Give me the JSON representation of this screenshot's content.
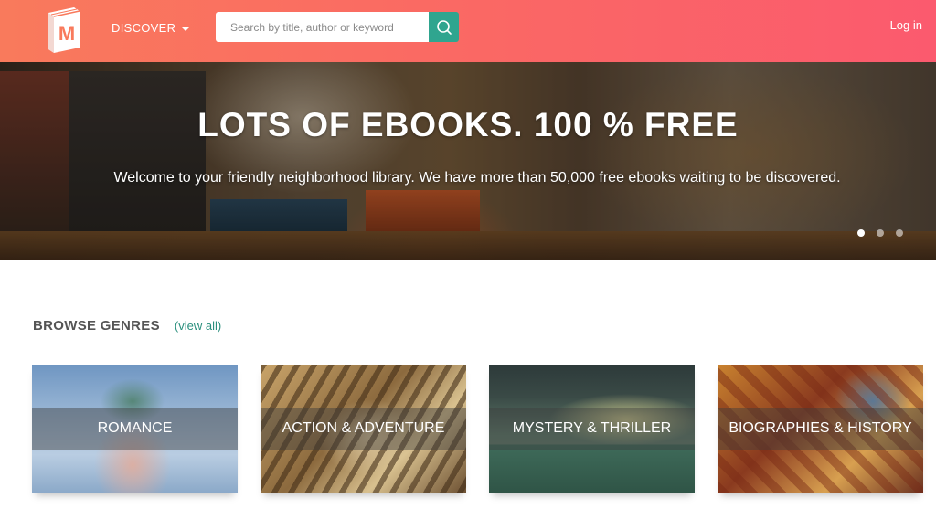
{
  "header": {
    "discover_label": "DISCOVER",
    "search_placeholder": "Search by title, author or keyword",
    "login_label": "Log in",
    "logo_letter": "M",
    "colors": {
      "gradient_start": "#f97a5c",
      "gradient_end": "#fb5a6e",
      "search_button": "#2fa58f"
    }
  },
  "hero": {
    "title": "LOTS OF EBOOKS. 100 % FREE",
    "subtitle": "Welcome to your friendly neighborhood library. We have more than 50,000 free ebooks waiting to be discovered.",
    "slides": 3,
    "active_slide": 1
  },
  "genres": {
    "heading": "BROWSE GENRES",
    "view_all_label": "(view all)",
    "items": [
      {
        "label": "ROMANCE"
      },
      {
        "label": "ACTION & ADVENTURE"
      },
      {
        "label": "MYSTERY & THRILLER"
      },
      {
        "label": "BIOGRAPHIES & HISTORY"
      }
    ]
  }
}
